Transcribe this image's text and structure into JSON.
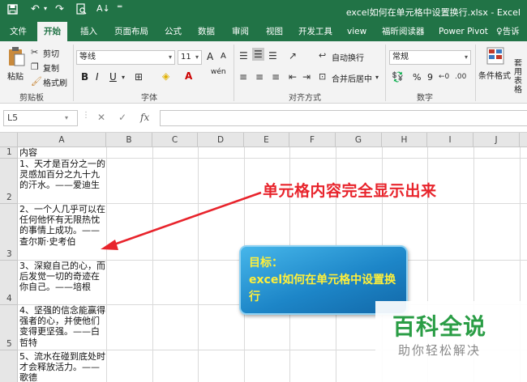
{
  "titlebar": {
    "save_icon": "save-icon",
    "undo_icon": "undo-icon",
    "redo_icon": "redo-icon",
    "print_preview_icon": "print-preview-icon",
    "sort_icon": "sort-icon",
    "customize_icon": "customize-icon",
    "title": "excel如何在单元格中设置换行.xlsx - Excel"
  },
  "tabs": [
    "文件",
    "开始",
    "插入",
    "页面布局",
    "公式",
    "数据",
    "审阅",
    "视图",
    "开发工具",
    "view",
    "福昕阅读器",
    "Power Pivot",
    "告诉"
  ],
  "ribbon": {
    "clipboard": {
      "paste": "粘贴",
      "cut": "剪切",
      "copy": "复制",
      "format_painter": "格式刷",
      "label": "剪贴板"
    },
    "font": {
      "font_name": "等线",
      "font_size": "11",
      "grow": "A",
      "shrink": "A",
      "bold": "B",
      "italic": "I",
      "underline": "U",
      "wen": "wén",
      "label": "字体"
    },
    "alignment": {
      "wrap_text": "自动换行",
      "merge_center": "合并后居中",
      "label": "对齐方式"
    },
    "number": {
      "format": "常规",
      "percent": "%",
      "comma": "9",
      "label": "数字"
    },
    "styles": {
      "conditional": "条件格式",
      "table": "套用表格"
    }
  },
  "formula_bar": {
    "name_box": "L5",
    "cancel": "✕",
    "enter": "✓",
    "fx": "fx",
    "value": ""
  },
  "grid": {
    "columns": [
      "A",
      "B",
      "C",
      "D",
      "E",
      "F",
      "G",
      "H",
      "I",
      "J"
    ],
    "rows": [
      "1",
      "2",
      "3",
      "4",
      "5"
    ],
    "cells": [
      "内容",
      "1、天才是百分之一的灵感加百分之九十九的汗水。——爱迪生",
      "2、一个人几乎可以在任何他怀有无限热忱的事情上成功。——查尔斯·史考伯",
      "3、深窥自己的心，而后发觉一切的奇迹在你自己。——培根",
      "4、坚强的信念能赢得强者的心，并使他们变得更坚强。——白哲特",
      "5、流水在碰到底处时才会释放活力。——歌德"
    ]
  },
  "annotation": "单元格内容完全显示出来",
  "callout": {
    "line1": "目标：",
    "line2": "excel如何在单元格中设置换行"
  },
  "watermark": {
    "logo": "百科全说",
    "tagline": "助你轻松解决"
  },
  "colors": {
    "excel_green": "#217346",
    "annotation_red": "#e8242c",
    "callout_blue": "#1d86c8",
    "callout_text": "#ffef3a",
    "watermark_green": "#2a9d45"
  }
}
